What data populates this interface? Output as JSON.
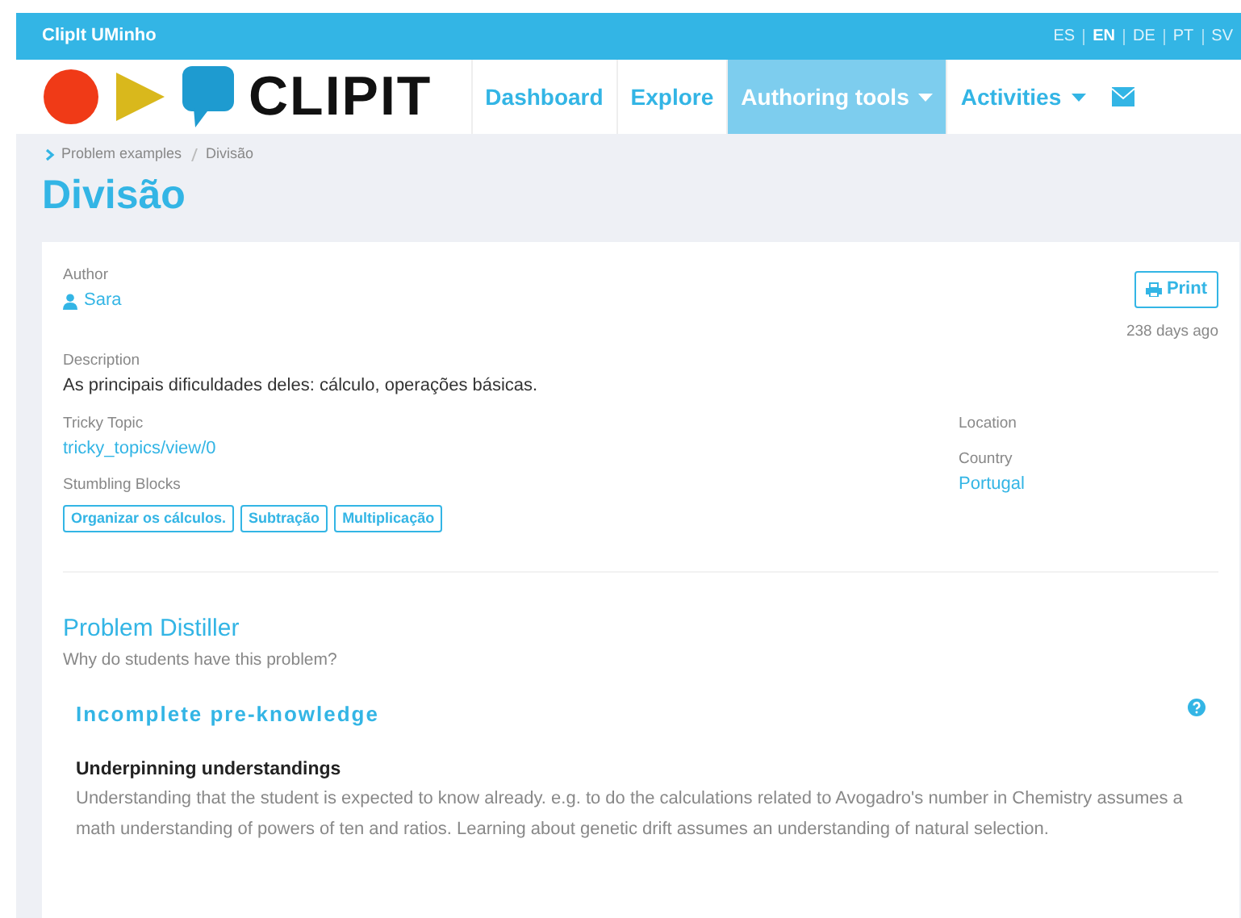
{
  "top_bar": {
    "site_name": "ClipIt UMinho",
    "languages": [
      {
        "label": "ES",
        "selected": false
      },
      {
        "label": "EN",
        "selected": true
      },
      {
        "label": "DE",
        "selected": false
      },
      {
        "label": "PT",
        "selected": false
      },
      {
        "label": "SV",
        "selected": false
      }
    ]
  },
  "logo": {
    "text": "CLIPIT"
  },
  "nav": [
    {
      "label": "Dashboard",
      "selected": false,
      "dropdown": false
    },
    {
      "label": "Explore",
      "selected": false,
      "dropdown": false
    },
    {
      "label": "Authoring tools",
      "selected": true,
      "dropdown": true
    },
    {
      "label": "Activities",
      "selected": false,
      "dropdown": true
    }
  ],
  "breadcrumb": [
    "Problem examples",
    "Divisão"
  ],
  "title": "Divisão",
  "details": {
    "author_label": "Author",
    "author": "Sara",
    "print": "Print",
    "age": "238 days ago",
    "description_label": "Description",
    "description": "As principais dificuldades deles: cálculo, operações básicas.",
    "tricky_topic_label": "Tricky Topic",
    "tricky_topic": "tricky_topics/view/0",
    "stumbling_blocks_label": "Stumbling Blocks",
    "stumbling_blocks": [
      "Organizar os cálculos.",
      "Subtração",
      "Multiplicação"
    ],
    "location_label": "Location",
    "country_label": "Country",
    "country": "Portugal"
  },
  "distiller": {
    "title": "Problem Distiller",
    "subtitle": "Why do students have this problem?",
    "category": "Incomplete pre-knowledge",
    "heading": "Underpinning understandings",
    "text": "Understanding that the student is expected to know already. e.g. to do the calculations related to Avogadro's number in Chemistry assumes a math understanding of powers of ten and ratios. Learning about genetic drift assumes an understanding of natural selection."
  }
}
